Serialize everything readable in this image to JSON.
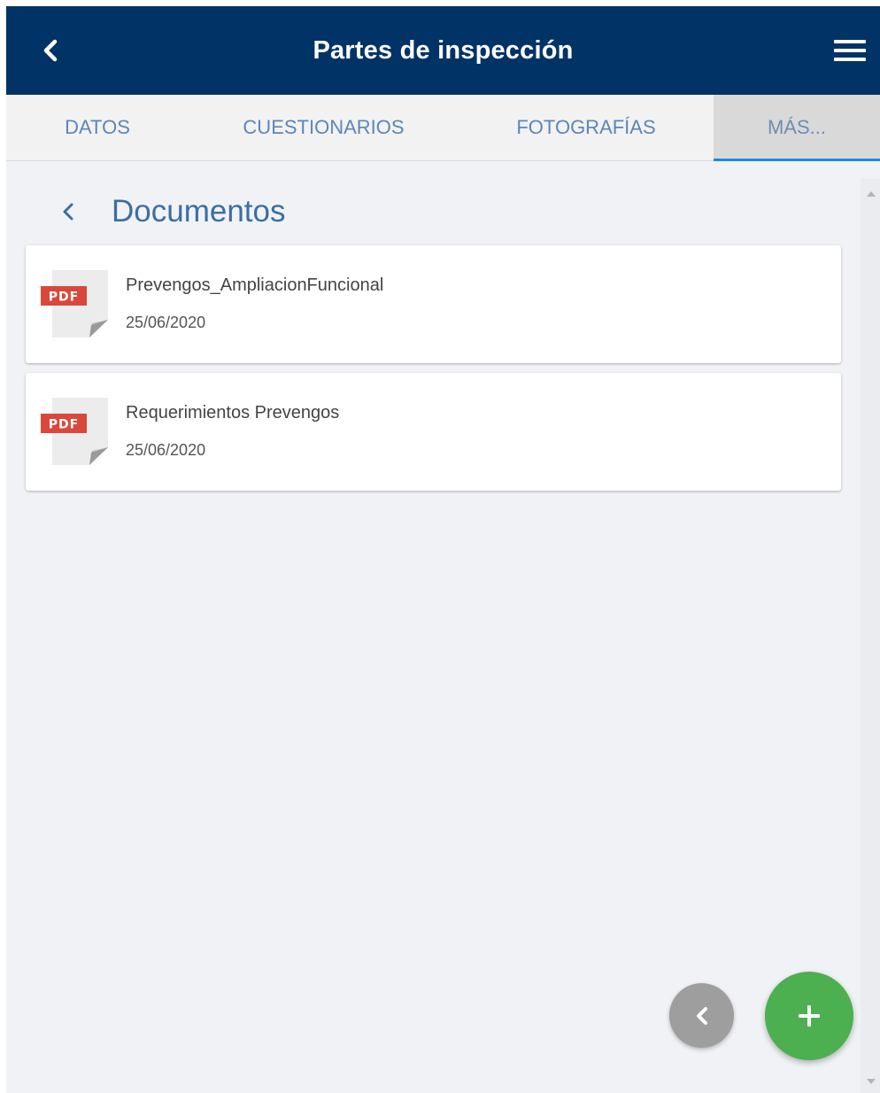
{
  "header": {
    "title": "Partes de inspección",
    "background_color": "#023366",
    "back_icon": "chevron-left-icon",
    "menu_icon": "hamburger-menu-icon"
  },
  "tabs": [
    {
      "label": "DATOS",
      "active": false
    },
    {
      "label": "CUESTIONARIOS",
      "active": false
    },
    {
      "label": "FOTOGRAFÍAS",
      "active": false
    },
    {
      "label": "MÁS...",
      "active": true
    }
  ],
  "section": {
    "title": "Documentos",
    "back_icon": "chevron-left-icon"
  },
  "documents": [
    {
      "badge": "PDF",
      "name": "Prevengos_AmpliacionFuncional",
      "date": "25/06/2020"
    },
    {
      "badge": "PDF",
      "name": "Requerimientos Prevengos",
      "date": "25/06/2020"
    }
  ],
  "fabs": {
    "back_icon": "chevron-left-icon",
    "add_icon": "plus-icon",
    "add_color": "#4caf50",
    "back_color": "#9e9e9e"
  },
  "colors": {
    "accent": "#1e88e5",
    "tab_text": "#5b87b9",
    "pdf_badge": "#d9483b"
  }
}
